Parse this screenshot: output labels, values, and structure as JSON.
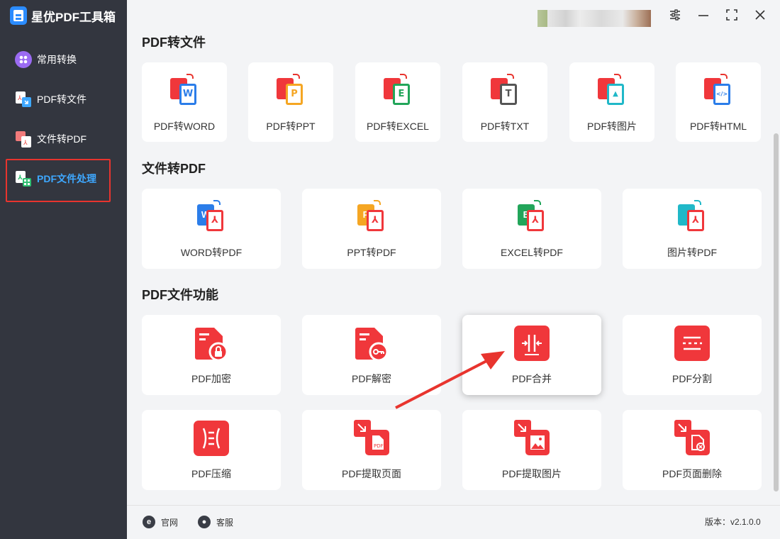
{
  "app": {
    "title": "星优PDF工具箱"
  },
  "sidebar": {
    "items": [
      {
        "label": "常用转换",
        "icon": "apps-icon"
      },
      {
        "label": "PDF转文件",
        "icon": "pdf-to-file-icon"
      },
      {
        "label": "文件转PDF",
        "icon": "file-to-pdf-icon"
      },
      {
        "label": "PDF文件处理",
        "icon": "pdf-process-icon",
        "active": true
      }
    ]
  },
  "sections": {
    "pdf_to_file": {
      "title": "PDF转文件",
      "items": [
        "PDF转WORD",
        "PDF转PPT",
        "PDF转EXCEL",
        "PDF转TXT",
        "PDF转图片",
        "PDF转HTML"
      ]
    },
    "file_to_pdf": {
      "title": "文件转PDF",
      "items": [
        "WORD转PDF",
        "PPT转PDF",
        "EXCEL转PDF",
        "图片转PDF"
      ]
    },
    "pdf_functions": {
      "title": "PDF文件功能",
      "items": [
        "PDF加密",
        "PDF解密",
        "PDF合并",
        "PDF分割",
        "PDF压缩",
        "PDF提取页面",
        "PDF提取图片",
        "PDF页面删除"
      ]
    }
  },
  "doc_letters": {
    "word": "W",
    "ppt": "P",
    "excel": "E",
    "txt": "T",
    "html": "</>"
  },
  "footer": {
    "website": "官网",
    "service": "客服",
    "version": "版本：v2.1.0.0"
  },
  "colors": {
    "accent": "#3ea8ff",
    "red": "#f0373b",
    "sidebar": "#33363f",
    "highlight": "#e8342e"
  }
}
